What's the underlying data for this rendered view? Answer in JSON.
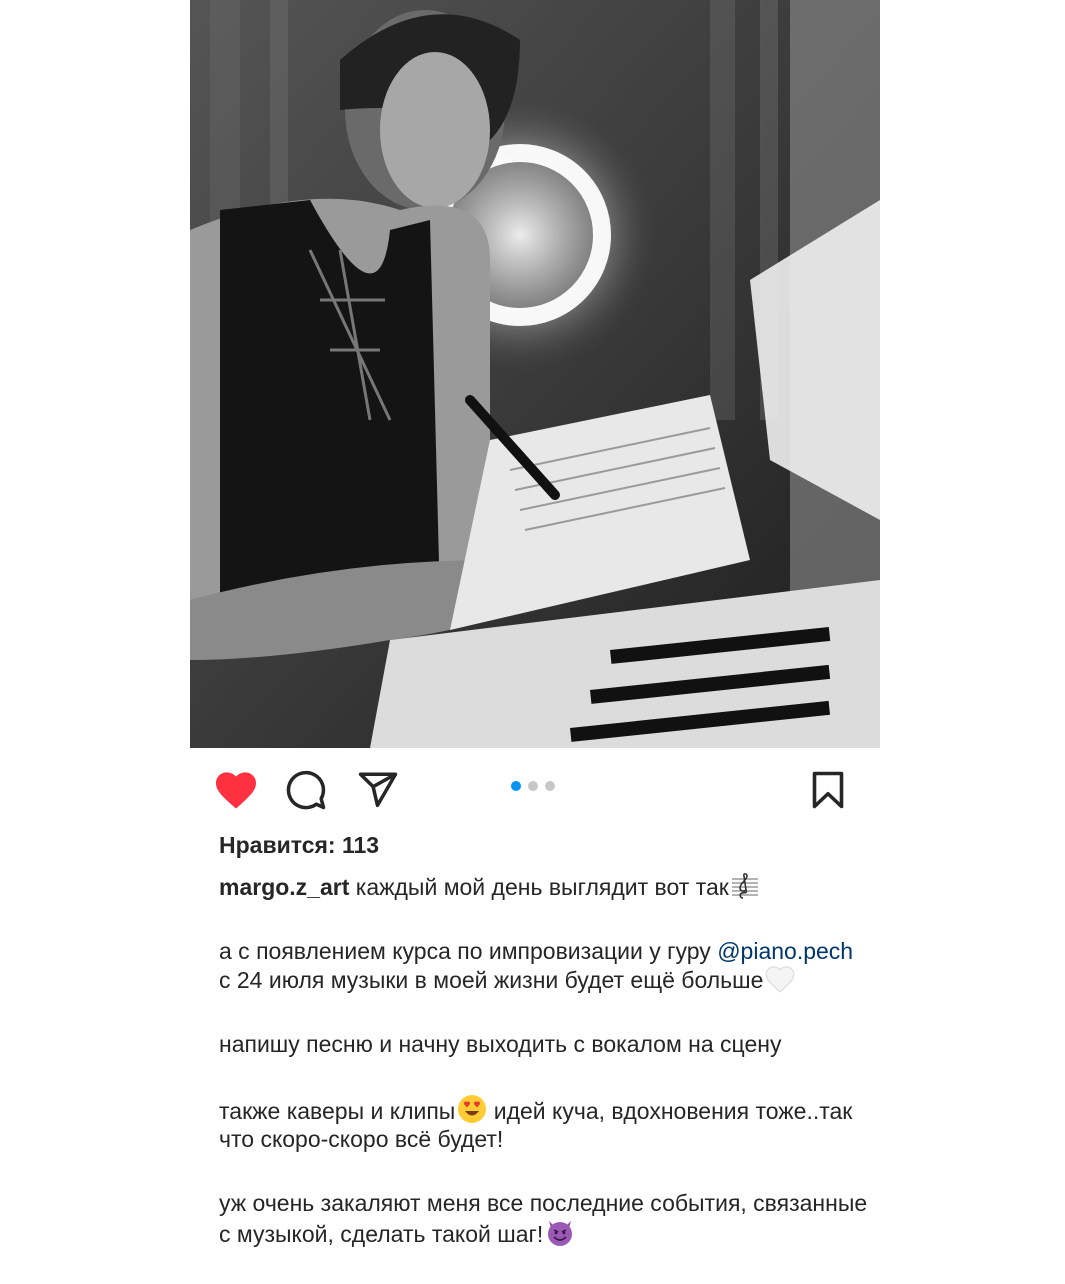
{
  "post": {
    "image_alt": "Black-and-white photo of a tattooed woman writing sheet music at a piano with a ring light behind her",
    "carousel": {
      "total": 3,
      "active": 0
    }
  },
  "actions": {
    "liked": true,
    "like_icon": "heart-icon",
    "comment_icon": "comment-icon",
    "share_icon": "send-icon",
    "save_icon": "bookmark-icon",
    "like_color": "#ff3040",
    "accent_color": "#0095f6"
  },
  "likes": {
    "label": "Нравится: 113"
  },
  "caption": {
    "username": "margo.z_art",
    "line1": " каждый мой день выглядит вот так",
    "para2_before": "а с появлением курса по импровизации у гуру ",
    "mention": "@piano.pech",
    "para2_after": " с 24 июля музыки в моей жизни будет ещё больше",
    "para3": "напишу песню и начну выходить с вокалом на сцену",
    "para4_before": "также каверы и клипы",
    "para4_after": " идей куча, вдохновения тоже..так что скоро-скоро всё будет!",
    "para5": "уж очень закаляют меня все последние события, связанные с музыкой, сделать такой шаг!"
  }
}
